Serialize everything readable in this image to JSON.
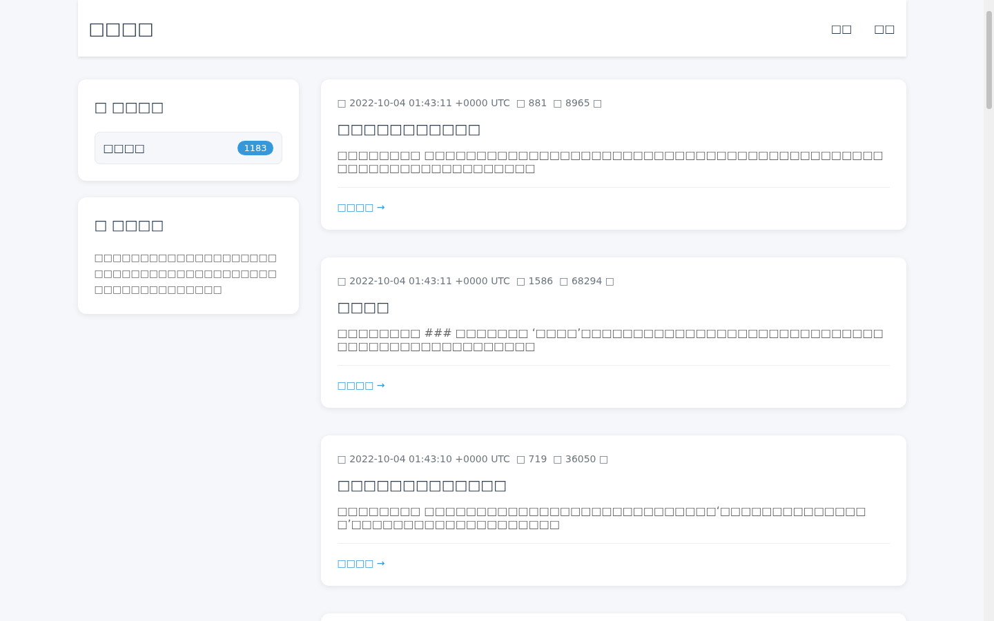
{
  "header": {
    "logo": "□□□□",
    "nav": [
      {
        "label": "□□"
      },
      {
        "label": "□□"
      }
    ]
  },
  "sidebar": {
    "categories": {
      "title": "□ □□□□",
      "items": [
        {
          "label": "□□□□",
          "count": "1183"
        }
      ]
    },
    "about": {
      "title": "□ □□□□",
      "text": "□□□□□□□□□□□□□□□□□□□□□□□□□□□□□□□□□□□□□□□□□□□□□□□□□□□□□□"
    }
  },
  "posts": [
    {
      "date": "□ 2022-10-04 01:43:11 +0000 UTC",
      "views": "□ 881",
      "words": "□ 8965 □",
      "title": "□□□□□□□□□□□",
      "excerpt": "□□□□□□□□ □□□□□□□□□□□□□□□□□□□□□□□□□□□□□□□□□□□□□□□□□□□□□□□□□□□□□□□□□□□□□□□",
      "link": "□□□□ →"
    },
    {
      "date": "□ 2022-10-04 01:43:11 +0000 UTC",
      "views": "□ 1586",
      "words": "□ 68294 □",
      "title": "□□□□",
      "excerpt": "□□□□□□□□ ### □□□□□□□ ‘□□□□’□□□□□□□□□□□□□□□□□□□□□□□□□□□□□□□□□□□□□□□□□□□□□□□□",
      "link": "□□□□ →"
    },
    {
      "date": "□ 2022-10-04 01:43:10 +0000 UTC",
      "views": "□ 719",
      "words": "□ 36050 □",
      "title": "□□□□□□□□□□□□□",
      "excerpt": "□□□□□□□□ □□□□□□□□□□□□□□□□□□□□□□□□□□□□‘□□□□□□□□□□□□□□□’□□□□□□□□□□□□□□□□□□□□",
      "link": "□□□□ →"
    }
  ]
}
